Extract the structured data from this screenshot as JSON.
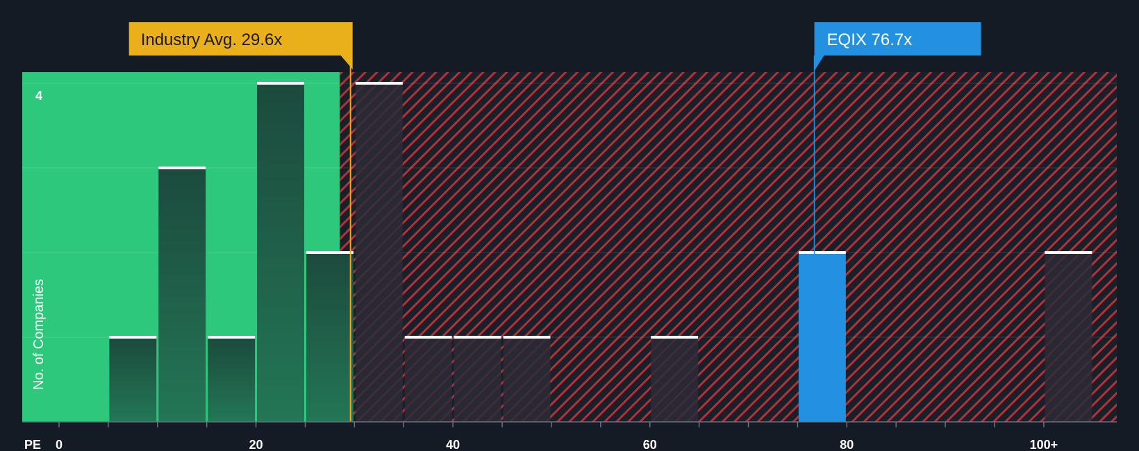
{
  "chart_data": {
    "type": "bar",
    "x_axis_label": "PE",
    "y_axis_label": "No. of Companies",
    "x_ticks": [
      "0",
      "20",
      "40",
      "60",
      "80",
      "100+"
    ],
    "y_tick_label": "4",
    "xlim": [
      -3.5,
      103.5
    ],
    "ylim": [
      0,
      4.15
    ],
    "bins": [
      {
        "from": 5,
        "to": 10,
        "count": 1,
        "highlight": false
      },
      {
        "from": 10,
        "to": 15,
        "count": 3,
        "highlight": false
      },
      {
        "from": 15,
        "to": 20,
        "count": 1,
        "highlight": false
      },
      {
        "from": 20,
        "to": 25,
        "count": 4,
        "highlight": false
      },
      {
        "from": 25,
        "to": 30,
        "count": 2,
        "highlight": false
      },
      {
        "from": 30,
        "to": 35,
        "count": 4,
        "highlight": false
      },
      {
        "from": 35,
        "to": 40,
        "count": 1,
        "highlight": false
      },
      {
        "from": 40,
        "to": 45,
        "count": 1,
        "highlight": false
      },
      {
        "from": 45,
        "to": 50,
        "count": 1,
        "highlight": false
      },
      {
        "from": 60,
        "to": 65,
        "count": 1,
        "highlight": false
      },
      {
        "from": 75,
        "to": 80,
        "count": 2,
        "highlight": true
      },
      {
        "from": 100,
        "to": 105,
        "count": 2,
        "highlight": false
      }
    ],
    "industry_avg": {
      "label": "Industry Avg. 29.6x",
      "value": 29.6
    },
    "company": {
      "label": "EQIX 76.7x",
      "value": 76.7
    },
    "fair_zone_end": 28.5,
    "colors": {
      "background": "#151b24",
      "fair_zone": "#2ec87c",
      "bar_dark": "#1e4a3c",
      "bar_dark_end": "#237a55",
      "over_zone_stripe": "#c0392b",
      "bar_over": "#2a2c36",
      "company_bar": "#2491e0",
      "industry_line": "#f5a623",
      "industry_label_bg": "#eab01b",
      "company_label_bg": "#2491e0",
      "bar_cap": "#ffffff",
      "text": "#ffffff"
    }
  }
}
